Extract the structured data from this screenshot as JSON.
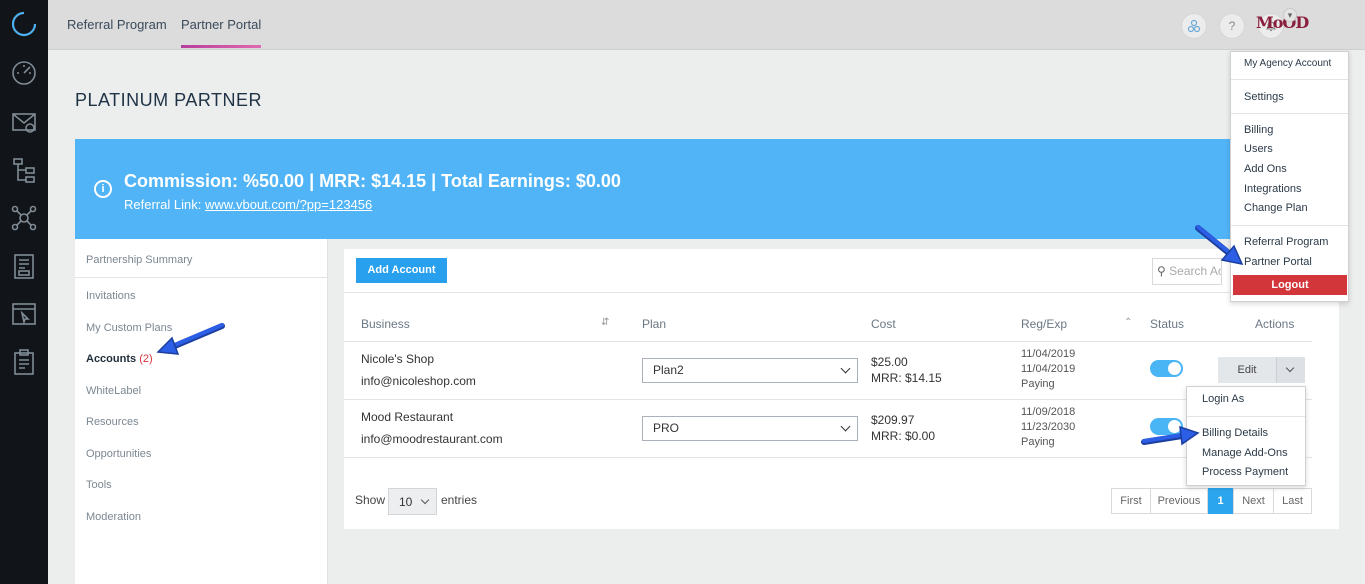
{
  "nav_rail": {
    "icons": [
      "loading-ring-icon",
      "speedometer-icon",
      "envelope-icon",
      "hierarchy-icon",
      "network-icon",
      "landing-page-icon",
      "browser-click-icon",
      "clipboard-icon"
    ]
  },
  "topbar": {
    "tabs": [
      {
        "label": "Referral Program"
      },
      {
        "label": "Partner Portal"
      }
    ],
    "help_glyph": "?",
    "logo_text": "MoOD"
  },
  "page": {
    "title": "PLATINUM PARTNER"
  },
  "banner": {
    "info_glyph": "i",
    "headline": "Commission: %50.00 | MRR: $14.15 | Total Earnings: $0.00",
    "link_label": "Referral Link:",
    "link_url": "www.vbout.com/?pp=123456",
    "color": "#51b4f6"
  },
  "sidebar": {
    "items": [
      {
        "label": "Partnership Summary"
      },
      {
        "label": "Invitations"
      },
      {
        "label": "My Custom Plans"
      },
      {
        "label": "Accounts",
        "count": "(2)"
      },
      {
        "label": "WhiteLabel"
      },
      {
        "label": "Resources"
      },
      {
        "label": "Opportunities"
      },
      {
        "label": "Tools"
      },
      {
        "label": "Moderation"
      }
    ]
  },
  "accounts": {
    "add_button": "Add Account",
    "search_placeholder": "Search Ac",
    "columns": [
      "Business",
      "Plan",
      "Cost",
      "Reg/Exp",
      "Status",
      "Actions"
    ],
    "rows": [
      {
        "name": "Nicole's Shop",
        "email": "info@nicoleshop.com",
        "plan": "Plan2",
        "cost": "$25.00",
        "mrr": "MRR: $14.15",
        "reg": "11/04/2019",
        "exp": "11/04/2019",
        "state": "Paying",
        "status_on": true
      },
      {
        "name": "Mood Restaurant",
        "email": "info@moodrestaurant.com",
        "plan": "PRO",
        "cost": "$209.97",
        "mrr": "MRR: $0.00",
        "reg": "11/09/2018",
        "exp": "11/23/2030",
        "state": "Paying",
        "status_on": true
      }
    ],
    "edit_label": "Edit",
    "show_label": "Show",
    "per_page": "10",
    "entries_label": "entries",
    "pagination": [
      "First",
      "Previous",
      "1",
      "Next",
      "Last"
    ]
  },
  "row_actions_menu": {
    "items": [
      "Login As",
      "Billing Details",
      "Manage Add-Ons",
      "Process Payment"
    ]
  },
  "account_menu": {
    "header": "My Agency Account",
    "items": [
      "Settings",
      "Billing",
      "Users",
      "Add Ons",
      "Integrations",
      "Change Plan",
      "Referral Program",
      "Partner Portal"
    ],
    "logout": "Logout",
    "logout_color": "#d2363a"
  },
  "annotation_color": "#2c5ee6"
}
